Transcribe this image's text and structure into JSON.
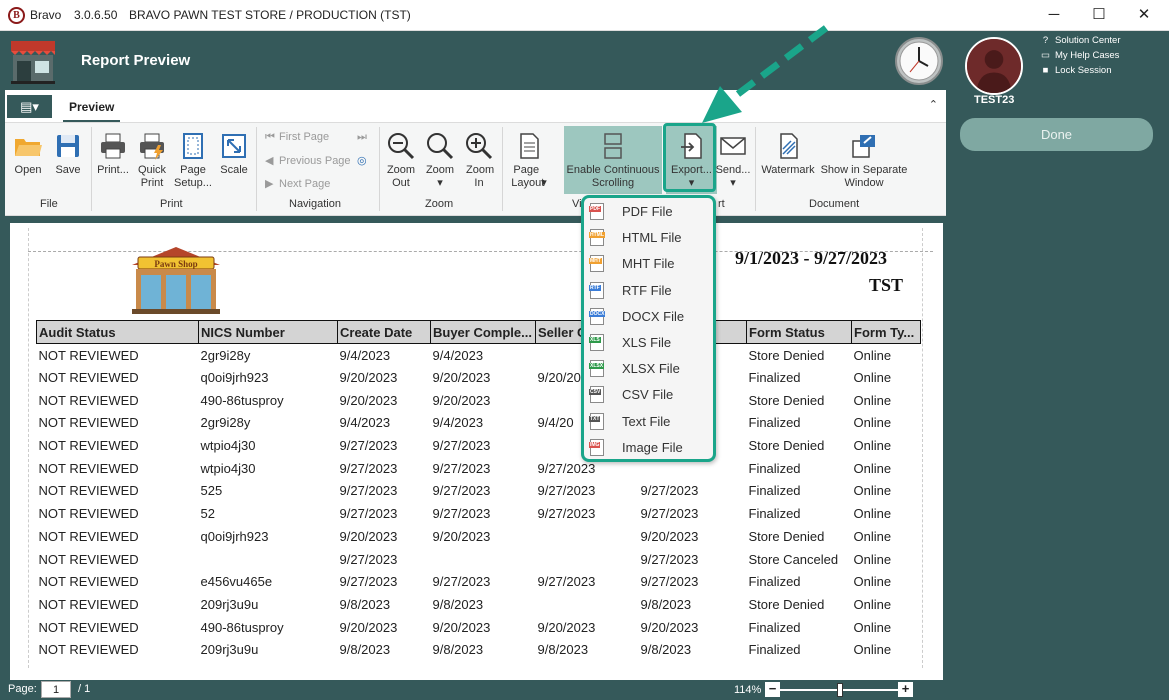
{
  "titlebar": {
    "logo_letter": "B",
    "app_name": "Bravo",
    "version": "3.0.6.50",
    "store": "BRAVO PAWN TEST STORE / PRODUCTION (TST)",
    "minimize": "─",
    "maximize": "☐",
    "close": "✕"
  },
  "header": {
    "title": "Report Preview"
  },
  "user_panel": {
    "username": "TEST23",
    "links": [
      {
        "label": "Solution Center",
        "icon": "help-circle-icon"
      },
      {
        "label": "My Help Cases",
        "icon": "folder-icon"
      },
      {
        "label": "Lock Session",
        "icon": "lock-icon"
      }
    ],
    "done_label": "Done"
  },
  "preview": {
    "app_menu_label": "▤▾",
    "tab_label": "Preview",
    "collapse_glyph": "⌃"
  },
  "ribbon": {
    "file": {
      "group": "File",
      "open": "Open",
      "save": "Save"
    },
    "print": {
      "group": "Print",
      "print": "Print...",
      "quick_print": "Quick Print",
      "page_setup": "Page Setup...",
      "scale": "Scale"
    },
    "navigation": {
      "group": "Navigation",
      "first": "First Page",
      "previous": "Previous Page",
      "next": "Next Page"
    },
    "zoom": {
      "group": "Zoom",
      "zoom_out": "Zoom Out",
      "zoom": "Zoom",
      "zoom_in": "Zoom In"
    },
    "view": {
      "group": "Vi",
      "page_layout": "Page Layout",
      "continuous": "Enable Continuous Scrolling"
    },
    "export": {
      "group": "rt",
      "export": "Export...",
      "send": "Send..."
    },
    "document": {
      "group": "Document",
      "watermark": "Watermark",
      "show_separate": "Show in Separate Window"
    }
  },
  "export_menu": [
    {
      "label": "PDF File",
      "tag": "PDF",
      "color": "#d9534f"
    },
    {
      "label": "HTML File",
      "tag": "HTML",
      "color": "#f0a030"
    },
    {
      "label": "MHT File",
      "tag": "MHT",
      "color": "#f0a030"
    },
    {
      "label": "RTF File",
      "tag": "RTF",
      "color": "#3b7dd8"
    },
    {
      "label": "DOCX File",
      "tag": "DOCX",
      "color": "#3b7dd8"
    },
    {
      "label": "XLS File",
      "tag": "XLS",
      "color": "#2e9a4a"
    },
    {
      "label": "XLSX File",
      "tag": "XLSX",
      "color": "#2e9a4a"
    },
    {
      "label": "CSV File",
      "tag": "CSV",
      "color": "#555555"
    },
    {
      "label": "Text File",
      "tag": "TXT",
      "color": "#555555"
    },
    {
      "label": "Image File",
      "tag": "IMG",
      "color": "#d9534f"
    }
  ],
  "report": {
    "logo_text": "Pawn Shop",
    "date_range": "9/1/2023 - 9/27/2023",
    "store_code": "TST",
    "columns": [
      "Audit Status",
      "NICS Number",
      "Create Date",
      "Buyer Comple...",
      "Seller C",
      "",
      "Form Status",
      "Form Ty..."
    ],
    "rows": [
      [
        "NOT REVIEWED",
        "2gr9i28y",
        "9/4/2023",
        "9/4/2023",
        "",
        "",
        "Store Denied",
        "Online"
      ],
      [
        "NOT REVIEWED",
        "q0oi9jrh923",
        "9/20/2023",
        "9/20/2023",
        "9/20/20",
        "",
        "Finalized",
        "Online"
      ],
      [
        "NOT REVIEWED",
        "490-86tusproy",
        "9/20/2023",
        "9/20/2023",
        "",
        "",
        "Store Denied",
        "Online"
      ],
      [
        "NOT REVIEWED",
        "2gr9i28y",
        "9/4/2023",
        "9/4/2023",
        "9/4/20",
        "",
        "Finalized",
        "Online"
      ],
      [
        "NOT REVIEWED",
        "wtpio4j30",
        "9/27/2023",
        "9/27/2023",
        "",
        "",
        "Store Denied",
        "Online"
      ],
      [
        "NOT REVIEWED",
        "wtpio4j30",
        "9/27/2023",
        "9/27/2023",
        "9/27/2023",
        "",
        "Finalized",
        "Online"
      ],
      [
        "NOT REVIEWED",
        "525",
        "9/27/2023",
        "9/27/2023",
        "9/27/2023",
        "9/27/2023",
        "Finalized",
        "Online"
      ],
      [
        "NOT REVIEWED",
        "52",
        "9/27/2023",
        "9/27/2023",
        "9/27/2023",
        "9/27/2023",
        "Finalized",
        "Online"
      ],
      [
        "NOT REVIEWED",
        "q0oi9jrh923",
        "9/20/2023",
        "9/20/2023",
        "",
        "9/20/2023",
        "Store Denied",
        "Online"
      ],
      [
        "NOT REVIEWED",
        "",
        "9/27/2023",
        "",
        "",
        "9/27/2023",
        "Store Canceled",
        "Online"
      ],
      [
        "NOT REVIEWED",
        "e456vu465e",
        "9/27/2023",
        "9/27/2023",
        "9/27/2023",
        "9/27/2023",
        "Finalized",
        "Online"
      ],
      [
        "NOT REVIEWED",
        "209rj3u9u",
        "9/8/2023",
        "9/8/2023",
        "",
        "9/8/2023",
        "Store Denied",
        "Online"
      ],
      [
        "NOT REVIEWED",
        "490-86tusproy",
        "9/20/2023",
        "9/20/2023",
        "9/20/2023",
        "9/20/2023",
        "Finalized",
        "Online"
      ],
      [
        "NOT REVIEWED",
        "209rj3u9u",
        "9/8/2023",
        "9/8/2023",
        "9/8/2023",
        "9/8/2023",
        "Finalized",
        "Online"
      ]
    ]
  },
  "statusbar": {
    "page_label": "Page:",
    "page_value": "1",
    "page_of": "/ 1",
    "zoom": "114%",
    "zoom_level_percent": 114,
    "minus": "−",
    "plus": "+"
  },
  "colors": {
    "frame": "#35595a",
    "accent": "#1aa58a",
    "done_button": "#7fa8a2"
  }
}
